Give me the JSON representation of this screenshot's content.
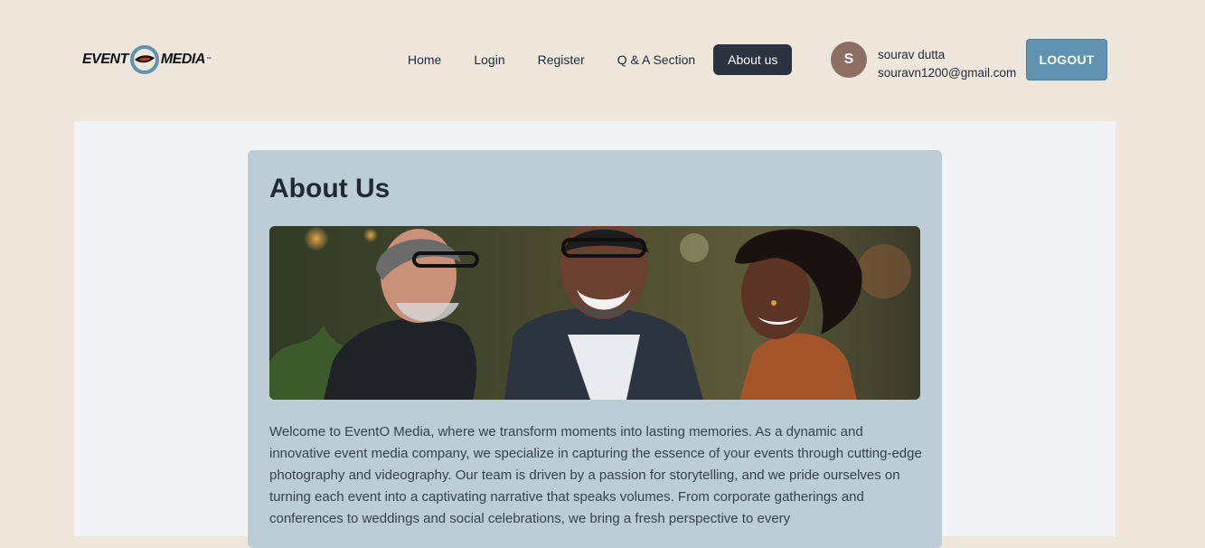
{
  "brand": {
    "logo_text_left": "EVENT",
    "logo_text_right": "MEDIA",
    "logo_tm": "™"
  },
  "nav": {
    "items": [
      {
        "label": "Home",
        "active": false
      },
      {
        "label": "Login",
        "active": false
      },
      {
        "label": "Register",
        "active": false
      },
      {
        "label": "Q & A Section",
        "active": false
      },
      {
        "label": "About us",
        "active": true
      }
    ]
  },
  "user": {
    "avatar_initial": "S",
    "name": "sourav dutta",
    "email": "souravn1200@gmail.com",
    "logout_label": "LOGOUT"
  },
  "about": {
    "title": "About Us",
    "hero_alt_icon": "photo-of-three-people-smiling",
    "body": "Welcome to EventO Media, where we transform moments into lasting memories. As a dynamic and innovative event media company, we specialize in capturing the essence of your events through cutting-edge photography and videography. Our team is driven by a passion for storytelling, and we pride ourselves on turning each event into a captivating narrative that speaks volumes. From corporate gatherings and conferences to weddings and social celebrations, we bring a fresh perspective to every"
  },
  "colors": {
    "page_bg": "#efe7db",
    "main_bg": "#f2f3f5",
    "card_bg": "#bccdd6",
    "active_nav": "#2b3240",
    "logout": "#5f93b0",
    "avatar": "#8c6e63"
  }
}
